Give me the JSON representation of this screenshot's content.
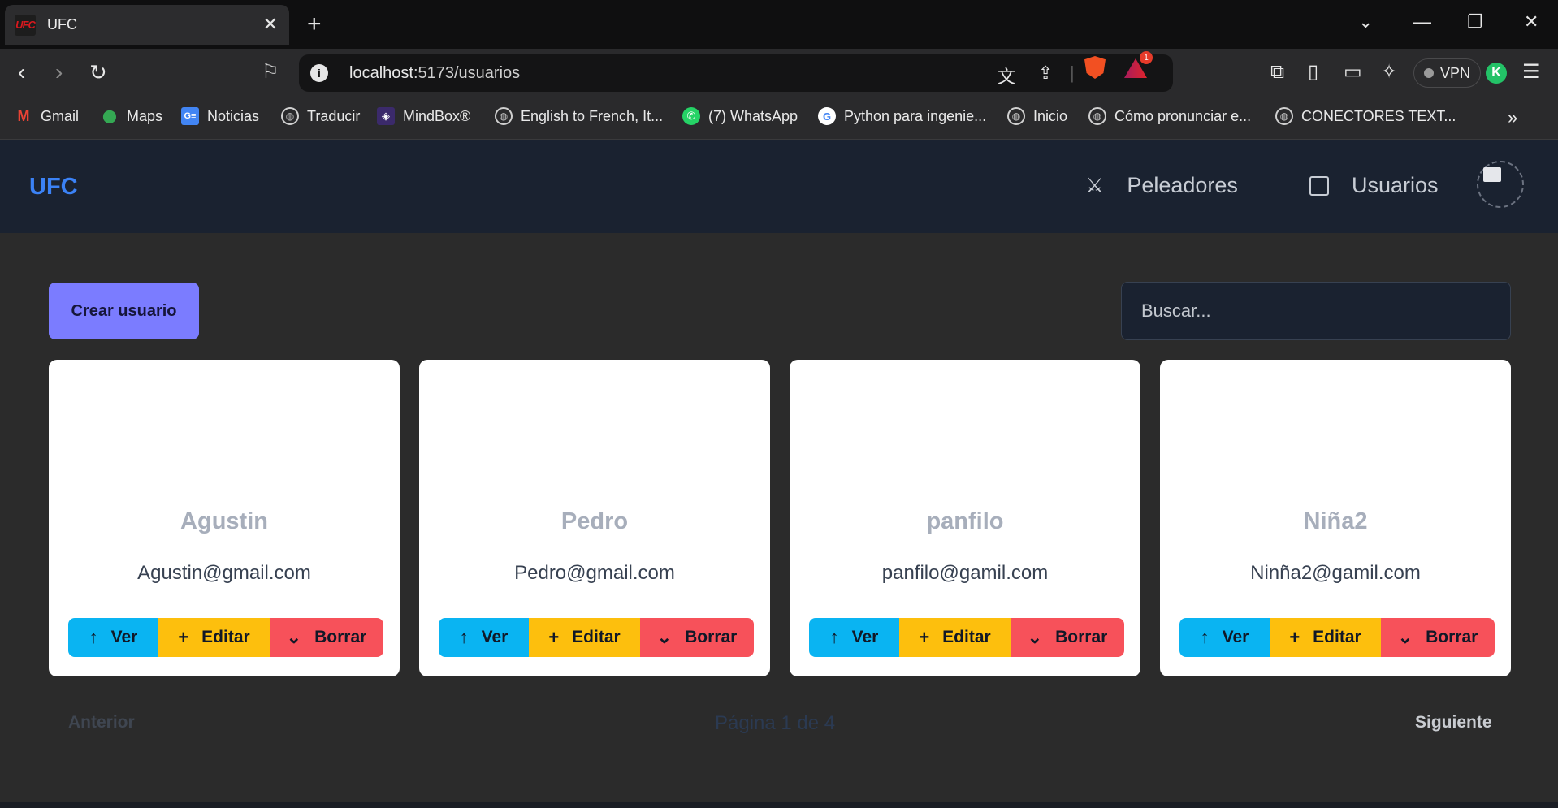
{
  "browser": {
    "tab_title": "UFC",
    "tab_favicon": "UFC",
    "url_host": "localhost",
    "url_path": ":5173/usuarios",
    "notification_count": "1",
    "vpn_label": "VPN",
    "profile_initial": "K",
    "bookmarks": [
      {
        "label": "Gmail",
        "icon": "M"
      },
      {
        "label": "Maps",
        "icon": "⬤"
      },
      {
        "label": "Noticias",
        "icon": "G≡"
      },
      {
        "label": "Traducir",
        "icon": "◍"
      },
      {
        "label": "MindBox®",
        "icon": "◈"
      },
      {
        "label": "English to French, It...",
        "icon": "◍"
      },
      {
        "label": "(7) WhatsApp",
        "icon": "✆"
      },
      {
        "label": "Python para ingenie...",
        "icon": "G"
      },
      {
        "label": "Inicio",
        "icon": "◍"
      },
      {
        "label": "Cómo pronunciar e...",
        "icon": "◍"
      },
      {
        "label": "CONECTORES TEXT...",
        "icon": "◍"
      }
    ],
    "overflow": "»"
  },
  "app": {
    "brand": "UFC",
    "nav": {
      "peleadores": "Peleadores",
      "usuarios": "Usuarios"
    },
    "create_button": "Crear usuario",
    "search_placeholder": "Buscar...",
    "actions": {
      "ver": "Ver",
      "editar": "Editar",
      "borrar": "Borrar",
      "ver_icon": "↑",
      "editar_icon": "+",
      "borrar_icon": "⌄"
    },
    "users": [
      {
        "name": "Agustin",
        "email": "Agustin@gmail.com"
      },
      {
        "name": "Pedro",
        "email": "Pedro@gmail.com"
      },
      {
        "name": "panfilo",
        "email": "panfilo@gamil.com"
      },
      {
        "name": "Niña2",
        "email": "Ninña2@gamil.com"
      }
    ],
    "pagination": {
      "prev": "Anterior",
      "info": "Página 1 de 4",
      "next": "Siguiente"
    }
  },
  "colors": {
    "accent": "#7b7cff",
    "brand": "#3b82f6",
    "ver": "#0ab4f2",
    "editar": "#fdbf0d",
    "borrar": "#f7515a"
  }
}
